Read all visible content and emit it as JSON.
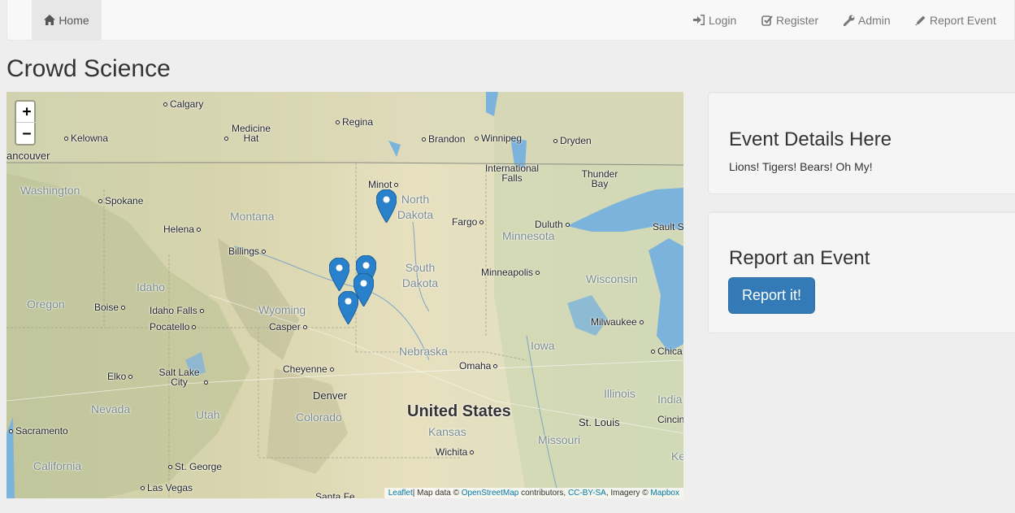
{
  "nav": {
    "home": "Home",
    "login": "Login",
    "register": "Register",
    "admin": "Admin",
    "report_event": "Report Event"
  },
  "page_title": "Crowd Science",
  "map": {
    "zoom_in": "+",
    "zoom_out": "−",
    "cities": {
      "calgary": "Calgary",
      "kelowna": "Kelowna",
      "vancouver": "ancouver",
      "medicine_hat": "Medicine Hat",
      "regina": "Regina",
      "brandon": "Brandon",
      "winnipeg": "Winnipeg",
      "dryden": "Dryden",
      "international_falls": "International Falls",
      "thunder_bay": "Thunder Bay",
      "minot": "Minot",
      "spokane": "Spokane",
      "fargo": "Fargo",
      "duluth": "Duluth",
      "sault": "Sault S",
      "helena": "Helena",
      "billings": "Billings",
      "minneapolis": "Minneapolis",
      "boise": "Boise",
      "idaho_falls": "Idaho Falls",
      "pocatello": "Pocatello",
      "casper": "Casper",
      "milwaukee": "Milwaukee",
      "chicago": "Chica",
      "elko": "Elko",
      "salt_lake": "Salt Lake City",
      "cheyenne": "Cheyenne",
      "omaha": "Omaha",
      "denver": "Denver",
      "st_louis": "St. Louis",
      "sacramento": "Sacramento",
      "wichita": "Wichita",
      "st_george": "St. George",
      "las_vegas": "Las Vegas",
      "cincin": "Cincin",
      "santa_fe": "Santa Fe"
    },
    "states": {
      "washington": "Washington",
      "montana": "Montana",
      "north_dakota": "North Dakota",
      "minnesota": "Minnesota",
      "idaho": "Idaho",
      "oregon": "Oregon",
      "wyoming": "Wyoming",
      "south_dakota": "South Dakota",
      "wisconsin": "Wisconsin",
      "nebraska": "Nebraska",
      "iowa": "Iowa",
      "nevada": "Nevada",
      "utah": "Utah",
      "colorado": "Colorado",
      "kansas": "Kansas",
      "missouri": "Missouri",
      "illinois": "Illinois",
      "indiana": "India",
      "california": "California",
      "kentucky": "Ke"
    },
    "country": "United States",
    "attribution": {
      "leaflet": "Leaflet",
      "map_data": "| Map data ©",
      "osm": "OpenStreetMap",
      "contributors": "contributors,",
      "ccbysa": "CC-BY-SA",
      "imagery": ", Imagery ©",
      "mapbox": "Mapbox"
    },
    "marker_color": "#2a81cb"
  },
  "event_details": {
    "title": "Event Details Here",
    "text": "Lions! Tigers! Bears! Oh My!"
  },
  "report": {
    "title": "Report an Event",
    "button": "Report it!"
  }
}
